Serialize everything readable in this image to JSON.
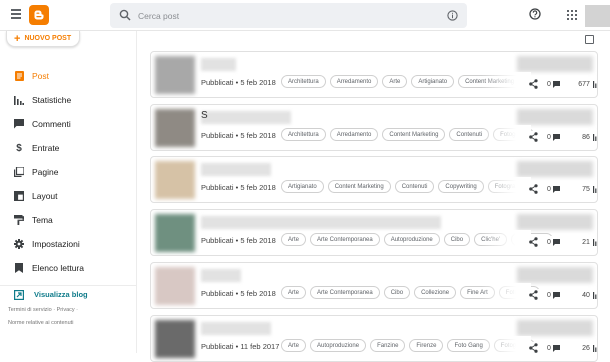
{
  "header": {
    "search_placeholder": "Cerca post",
    "menu_icon": "hamburger-menu-icon",
    "logo_icon": "blogger-logo-icon",
    "help_icon": "help-icon",
    "apps_icon": "apps-grid-icon"
  },
  "sidebar": {
    "new_post_label": "NUOVO POST",
    "items": [
      {
        "label": "Post",
        "icon": "post-icon",
        "active": true
      },
      {
        "label": "Statistiche",
        "icon": "stats-icon",
        "active": false
      },
      {
        "label": "Commenti",
        "icon": "comment-icon",
        "active": false
      },
      {
        "label": "Entrate",
        "icon": "dollar-icon",
        "active": false
      },
      {
        "label": "Pagine",
        "icon": "pages-icon",
        "active": false
      },
      {
        "label": "Layout",
        "icon": "layout-icon",
        "active": false
      },
      {
        "label": "Tema",
        "icon": "theme-icon",
        "active": false
      },
      {
        "label": "Impostazioni",
        "icon": "settings-icon",
        "active": false
      },
      {
        "label": "Elenco lettura",
        "icon": "bookmark-icon",
        "active": false
      }
    ],
    "view_blog_label": "Visualizza blog",
    "footer_line1": "Termini di servizio · Privacy ·",
    "footer_line2": "Norme relative ai contenuti"
  },
  "colors": {
    "accent": "#f57d00",
    "view_blog": "#0f7b8a"
  },
  "posts": [
    {
      "meta": "Pubblicati • 5 feb 2018",
      "tags": [
        "Architettura",
        "Arredamento",
        "Arte",
        "Artigianato",
        "Content Marketing"
      ],
      "comments": "0",
      "views": "677",
      "title_prefix": "",
      "thumb": "#a8a8a8"
    },
    {
      "meta": "Pubblicati • 5 feb 2018",
      "tags": [
        "Architettura",
        "Arredamento",
        "Content Marketing",
        "Contenuti",
        "Fotografia"
      ],
      "comments": "0",
      "views": "86",
      "title_prefix": "S",
      "thumb": "#8f8a84"
    },
    {
      "meta": "Pubblicati • 5 feb 2018",
      "tags": [
        "Artigianato",
        "Content Marketing",
        "Contenuti",
        "Copywriting",
        "Fotografia"
      ],
      "comments": "0",
      "views": "75",
      "title_prefix": "",
      "thumb": "#d6c2a6"
    },
    {
      "meta": "Pubblicati • 5 feb 2018",
      "tags": [
        "Arte",
        "Arte Contemporanea",
        "Autoproduzione",
        "Cibo",
        "Clic'he'",
        "Collezione"
      ],
      "comments": "0",
      "views": "21",
      "title_prefix": "",
      "thumb": "#6f9080"
    },
    {
      "meta": "Pubblicati • 5 feb 2018",
      "tags": [
        "Arte",
        "Arte Contemporanea",
        "Cibo",
        "Collezione",
        "Fine Art",
        "Fotografia"
      ],
      "comments": "0",
      "views": "40",
      "title_prefix": "",
      "thumb": "#d8c8c4"
    },
    {
      "meta": "Pubblicati • 11 feb 2017",
      "tags": [
        "Arte",
        "Autoproduzione",
        "Fanzine",
        "Firenze",
        "Foto Gang",
        "Fotografia"
      ],
      "comments": "0",
      "views": "26",
      "title_prefix": "",
      "thumb": "#6a6a6a"
    }
  ]
}
